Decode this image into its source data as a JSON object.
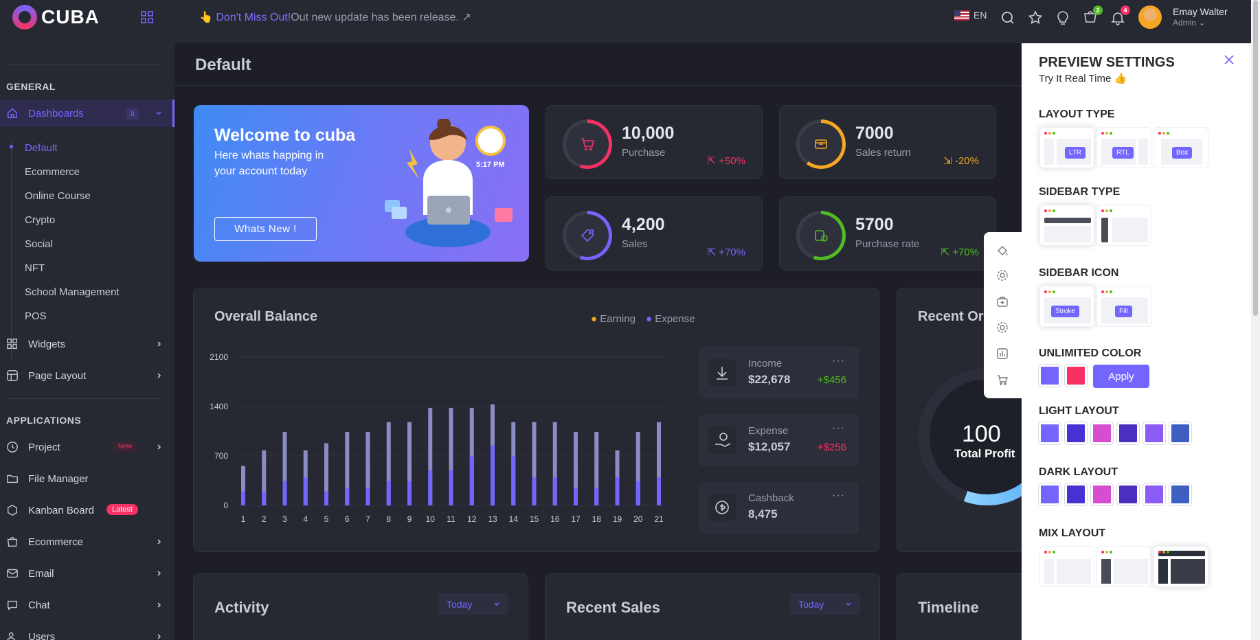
{
  "app": {
    "logo": "CUBA"
  },
  "notice": {
    "emoji": "👆",
    "highlight": "Don't Miss Out!",
    "text": "Out new update has been release.",
    "arrow": "↗"
  },
  "topbar": {
    "language": "EN",
    "cart_count": "2",
    "notif_count": "4",
    "user_name": "Emay Walter",
    "user_role": "Admin"
  },
  "sidebar": {
    "general_title": "GENERAL",
    "dashboards_label": "Dashboards",
    "dashboards_count": "8",
    "sub_items": [
      "Default",
      "Ecommerce",
      "Online Course",
      "Crypto",
      "Social",
      "NFT",
      "School Management",
      "POS"
    ],
    "widgets_label": "Widgets",
    "page_layout_label": "Page Layout",
    "applications_title": "APPLICATIONS",
    "project_label": "Project",
    "project_badge": "New",
    "file_manager_label": "File Manager",
    "kanban_label": "Kanban Board",
    "kanban_badge": "Latest",
    "ecommerce_label": "Ecommerce",
    "email_label": "Email",
    "chat_label": "Chat",
    "users_label": "Users"
  },
  "page": {
    "title": "Default"
  },
  "welcome": {
    "title": "Welcome to cuba",
    "subtitle": "Here whats happing in your account today",
    "button": "Whats New !",
    "time": "5:17 PM"
  },
  "stats": [
    {
      "value": "10,000",
      "label": "Purchase",
      "change": "+50%",
      "color": "#f73164"
    },
    {
      "value": "7000",
      "label": "Sales return",
      "change": "-20%",
      "color": "#f5a623"
    },
    {
      "value": "4,200",
      "label": "Sales",
      "change": "+70%",
      "color": "#7366ff"
    },
    {
      "value": "5700",
      "label": "Purchase rate",
      "change": "+70%",
      "color": "#51bb25"
    }
  ],
  "balance": {
    "title": "Overall Balance",
    "legend_earning": "Earning",
    "legend_expense": "Expense",
    "income_label": "Income",
    "income_value": "$22,678",
    "income_change": "+$456",
    "expense_label": "Expense",
    "expense_value": "$12,057",
    "expense_change": "+$256",
    "cashback_label": "Cashback",
    "cashback_value": "8,475",
    "more": "···"
  },
  "chart_data": {
    "type": "bar",
    "categories": [
      "1",
      "2",
      "3",
      "4",
      "5",
      "6",
      "7",
      "8",
      "9",
      "10",
      "11",
      "12",
      "13",
      "14",
      "15",
      "16",
      "17",
      "18",
      "19",
      "20",
      "21"
    ],
    "series": [
      {
        "name": "Earning",
        "values": [
          560,
          780,
          1040,
          780,
          880,
          1040,
          1040,
          1180,
          1180,
          1380,
          1380,
          1380,
          1430,
          1180,
          1180,
          1180,
          1040,
          1040,
          780,
          1040,
          1180
        ]
      },
      {
        "name": "Expense",
        "values": [
          200,
          200,
          350,
          400,
          200,
          250,
          250,
          350,
          350,
          500,
          500,
          700,
          850,
          700,
          400,
          400,
          250,
          250,
          400,
          350,
          400
        ]
      }
    ],
    "yticks": [
      "0",
      "700",
      "1400",
      "2100"
    ],
    "ylim": [
      0,
      2100
    ],
    "legend": "top",
    "colors": {
      "earning": "#8a8cc4",
      "expense": "#7366ff"
    }
  },
  "orders": {
    "title": "Recent Or",
    "value": "100",
    "label": "Total Profit"
  },
  "bottom": {
    "activity_title": "Activity",
    "sales_title": "Recent Sales",
    "timeline_title": "Timeline",
    "filter": "Today"
  },
  "preview": {
    "title": "PREVIEW SETTINGS",
    "subtitle": "Try It Real Time",
    "layout_type": "LAYOUT TYPE",
    "layout_options": [
      "LTR",
      "RTL",
      "Box"
    ],
    "sidebar_type": "SIDEBAR TYPE",
    "sidebar_icon": "SIDEBAR ICON",
    "icon_options": [
      "Stroke",
      "Fill"
    ],
    "unlimited_color": "UNLIMITED COLOR",
    "apply": "Apply",
    "light_layout": "LIGHT LAYOUT",
    "dark_layout": "DARK LAYOUT",
    "mix_layout": "MIX LAYOUT",
    "custom_colors": [
      "#7366ff",
      "#f73164"
    ],
    "palette": [
      "#7366ff",
      "#4831d4",
      "#d64dcf",
      "#4c2fbf",
      "#8a5cf5",
      "#3d5fc1"
    ]
  }
}
